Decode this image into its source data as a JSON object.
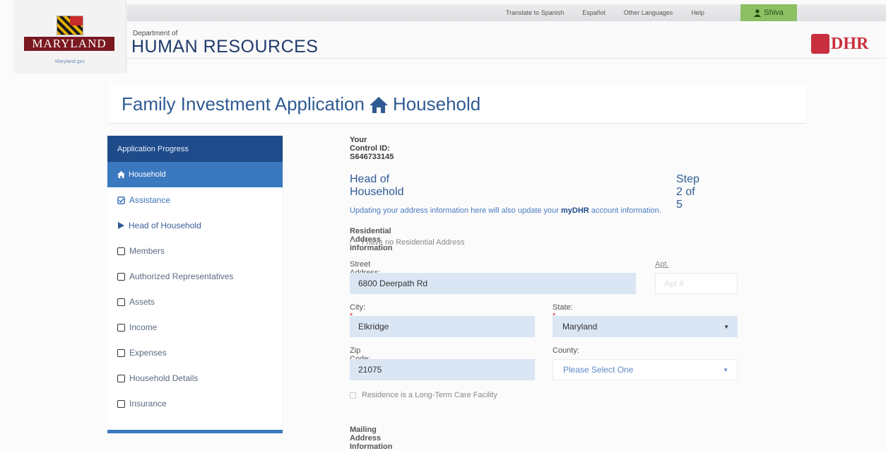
{
  "header": {
    "links": [
      "Translate to Spanish",
      "Español",
      "Other Languages",
      "Help"
    ],
    "user": "Shiva",
    "logo_word": "MARYLAND",
    "logo_sub": "Maryland.gov",
    "dept_small": "Department of",
    "dept_big": "HUMAN RESOURCES",
    "dhr_logo": "DHR"
  },
  "page": {
    "title_main": "Family Investment Application",
    "title_section": "Household"
  },
  "sidebar": {
    "heading": "Application Progress",
    "active": "Household",
    "items": [
      {
        "label": "Assistance",
        "state": "done"
      },
      {
        "label": "Head of Household",
        "state": "current"
      },
      {
        "label": "Members",
        "state": "todo"
      },
      {
        "label": "Authorized Representatives",
        "state": "todo"
      },
      {
        "label": "Assets",
        "state": "todo"
      },
      {
        "label": "Income",
        "state": "todo"
      },
      {
        "label": "Expenses",
        "state": "todo"
      },
      {
        "label": "Household Details",
        "state": "todo"
      },
      {
        "label": "Insurance",
        "state": "todo"
      }
    ]
  },
  "main": {
    "control_id": "Your Control ID: S646733145",
    "section_title": "Head of Household",
    "step": "Step 2 of 5",
    "notice_before": "Updating your address information here will also update your ",
    "notice_brand": "myDHR",
    "notice_after": " account information.",
    "residential_heading": "Residential Address Information",
    "no_address_label": "I have no Residential Address",
    "street_label": "Street Address:",
    "street_value": "6800 Deerpath Rd",
    "apt_label": "Apt.",
    "apt_placeholder": "Apt #",
    "city_label": "City:",
    "city_value": "Elkridge",
    "state_label": "State:",
    "state_value": "Maryland",
    "zip_label": "Zip Code:",
    "zip_value": "21075",
    "county_label": "County:",
    "county_value": "Please Select One",
    "ltc_label": "Residence is a Long-Term Care Facility",
    "mailing_heading": "Mailing Address Information"
  }
}
